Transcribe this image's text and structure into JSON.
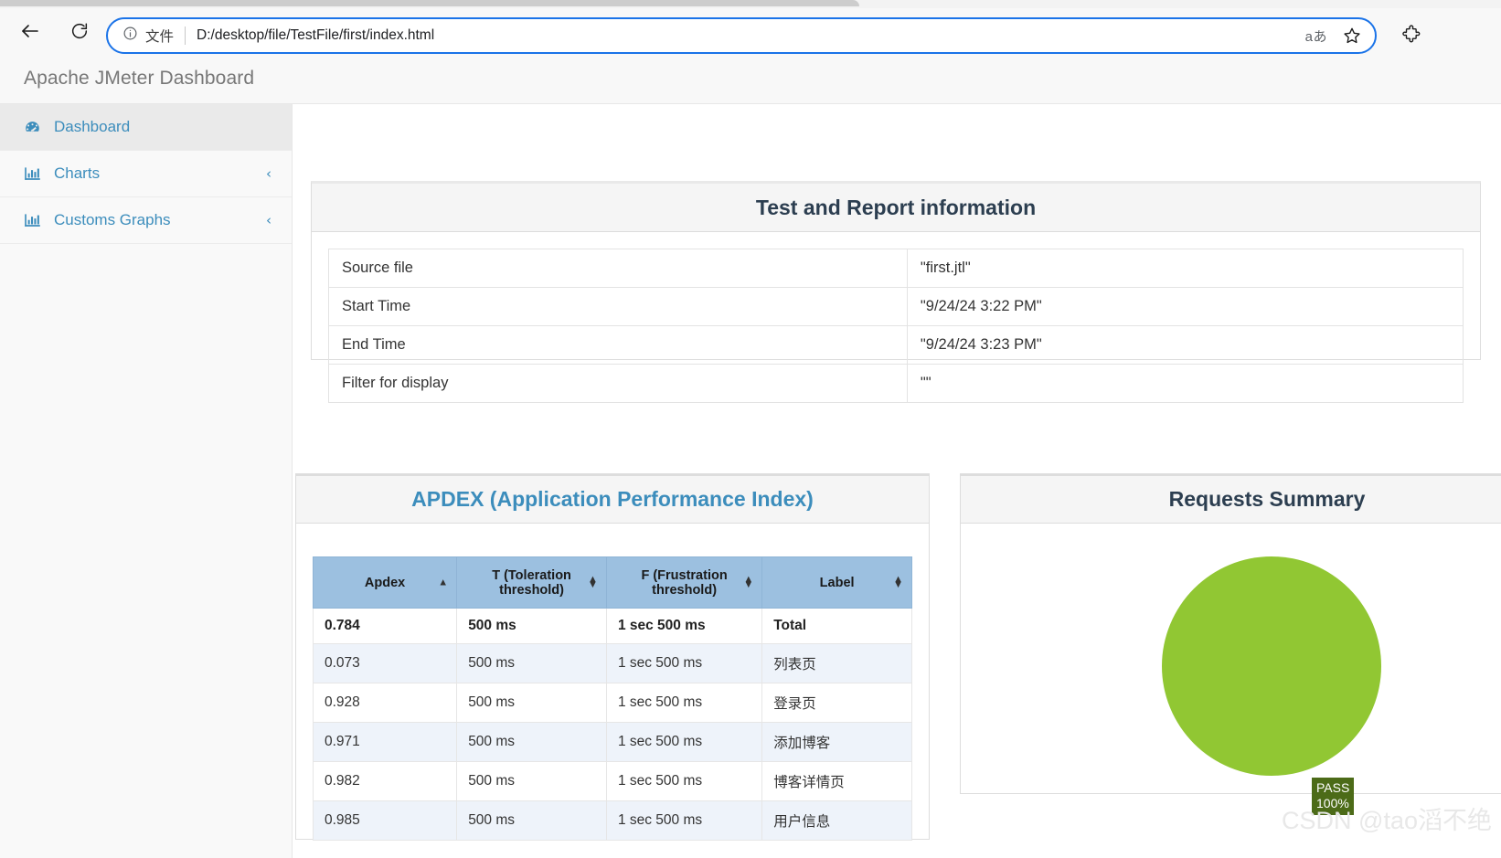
{
  "browser": {
    "back_label": "back-arrow",
    "reload_label": "reload",
    "scheme_label": "文件",
    "url": "D:/desktop/file/TestFile/first/index.html",
    "read_aloud_label": "aあ",
    "favorite_label": "favorite-star",
    "extensions_label": "extensions-puzzle"
  },
  "app": {
    "title": "Apache JMeter Dashboard"
  },
  "sidebar": {
    "items": [
      {
        "label": "Dashboard",
        "icon": "dashboard-gauge-icon",
        "active": true,
        "chevron": ""
      },
      {
        "label": "Charts",
        "icon": "bar-chart-icon",
        "active": false,
        "chevron": "‹"
      },
      {
        "label": "Customs Graphs",
        "icon": "bar-chart-icon",
        "active": false,
        "chevron": "‹"
      }
    ]
  },
  "test_info": {
    "title": "Test and Report information",
    "rows": [
      {
        "key": "Source file",
        "value": "\"first.jtl\""
      },
      {
        "key": "Start Time",
        "value": "\"9/24/24 3:22 PM\""
      },
      {
        "key": "End Time",
        "value": "\"9/24/24 3:23 PM\""
      },
      {
        "key": "Filter for display",
        "value": "\"\""
      }
    ]
  },
  "apdex": {
    "title": "APDEX (Application Performance Index)",
    "columns": [
      {
        "label": "Apdex",
        "sort": "asc"
      },
      {
        "label": "T (Toleration threshold)",
        "sort": "none"
      },
      {
        "label": "F (Frustration threshold)",
        "sort": "none"
      },
      {
        "label": "Label",
        "sort": "none"
      }
    ],
    "rows": [
      {
        "apdex": "0.784",
        "t": "500 ms",
        "f": "1 sec 500 ms",
        "label": "Total"
      },
      {
        "apdex": "0.073",
        "t": "500 ms",
        "f": "1 sec 500 ms",
        "label": "列表页"
      },
      {
        "apdex": "0.928",
        "t": "500 ms",
        "f": "1 sec 500 ms",
        "label": "登录页"
      },
      {
        "apdex": "0.971",
        "t": "500 ms",
        "f": "1 sec 500 ms",
        "label": "添加博客"
      },
      {
        "apdex": "0.982",
        "t": "500 ms",
        "f": "1 sec 500 ms",
        "label": "博客详情页"
      },
      {
        "apdex": "0.985",
        "t": "500 ms",
        "f": "1 sec 500 ms",
        "label": "用户信息"
      }
    ]
  },
  "requests_summary": {
    "title": "Requests Summary",
    "label_name": "PASS",
    "label_percent": "100%"
  },
  "chart_data": {
    "type": "pie",
    "title": "Requests Summary",
    "categories": [
      "PASS"
    ],
    "values": [
      100
    ],
    "labels": [
      "PASS 100%"
    ],
    "colors": [
      "#91c733"
    ],
    "label_background": "#4c6b18",
    "legend": "none",
    "units": "percent"
  },
  "watermark": {
    "text": "CSDN @tao滔不绝"
  },
  "colors": {
    "accent_blue": "#3c8dbc",
    "table_header_blue": "#9cc0e0",
    "pie_green": "#91c733",
    "pie_label_green": "#4c6b18",
    "panel_head_gray": "#f5f5f5",
    "title_dark": "#2c3e50"
  }
}
